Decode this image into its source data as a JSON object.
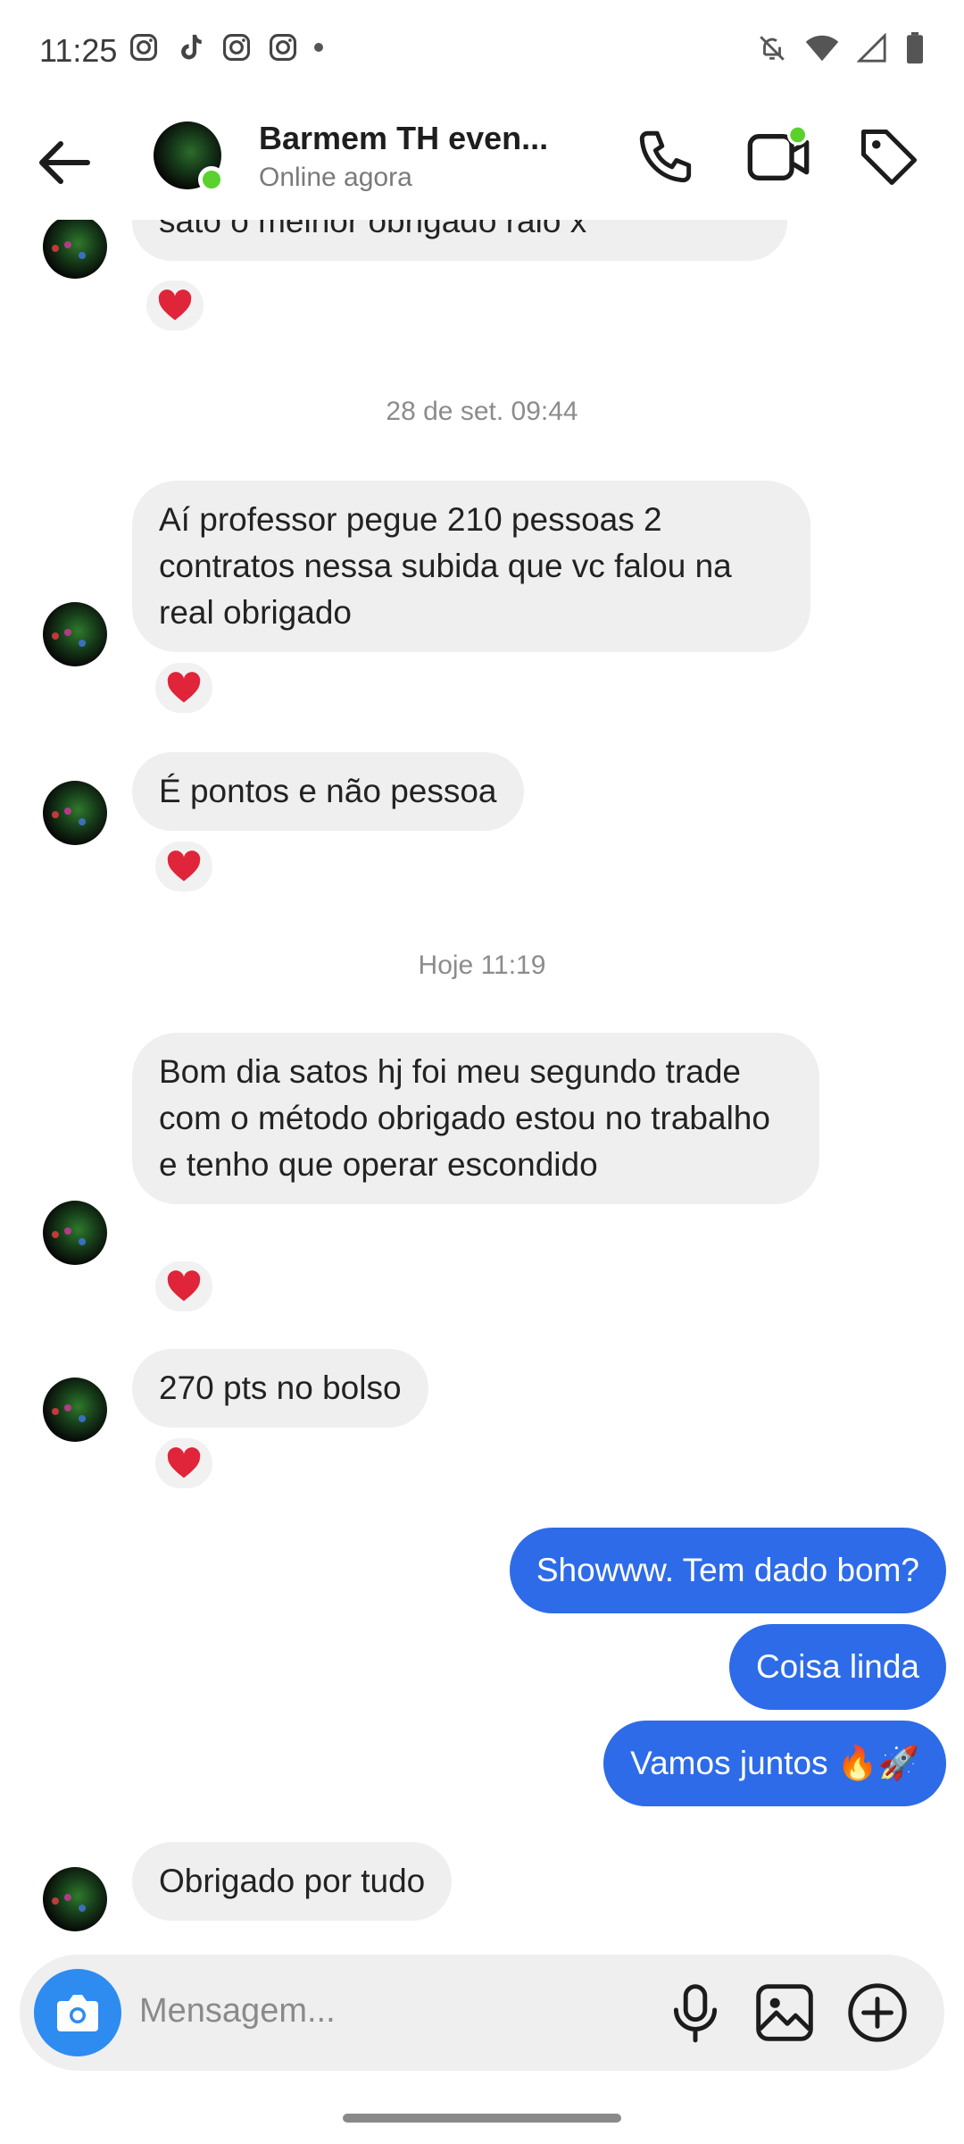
{
  "status_bar": {
    "time": "11:25",
    "left_icons": [
      "instagram-icon",
      "tiktok-icon",
      "instagram-icon",
      "instagram-icon",
      "dot-icon"
    ],
    "right_icons": [
      "bell-off-icon",
      "wifi-icon",
      "signal-icon",
      "battery-icon"
    ]
  },
  "header": {
    "name": "Barmem TH even...",
    "status": "Online agora",
    "online_color": "#5ad12d"
  },
  "chat": {
    "messages": [
      {
        "text": "sato o melhor obrigado raio x",
        "reaction": "❤️"
      },
      {
        "timestamp": "28 de set. 09:44"
      },
      {
        "text": "Aí professor pegue 210 pessoas 2 contratos nessa subida que vc falou na real obrigado",
        "reaction": "❤️"
      },
      {
        "text": "É pontos e não pessoa",
        "reaction": "❤️"
      },
      {
        "timestamp": "Hoje 11:19"
      },
      {
        "text": "Bom dia satos hj foi meu segundo trade com o método obrigado estou no trabalho e tenho que operar escondido",
        "reaction": "❤️"
      },
      {
        "text": "270 pts no bolso",
        "reaction": "❤️"
      },
      {
        "text": "Showww. Tem dado bom?",
        "outgoing": true
      },
      {
        "text": "Coisa linda",
        "outgoing": true
      },
      {
        "text": "Vamos juntos 🔥🚀",
        "outgoing": true
      },
      {
        "text": "Obrigado por tudo"
      }
    ],
    "outgoing_color": "#2d6be8",
    "incoming_color": "#efefef"
  },
  "composer": {
    "placeholder": "Mensagem...",
    "camera_color": "#2e8cf0"
  }
}
